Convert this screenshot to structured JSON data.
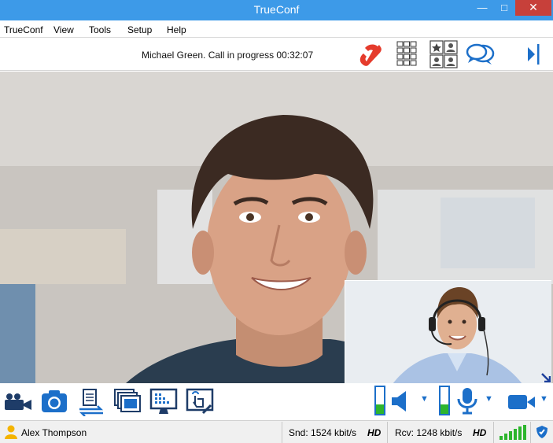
{
  "window": {
    "title": "TrueConf"
  },
  "menu": {
    "items": [
      "TrueConf",
      "View",
      "Tools",
      "Setup",
      "Help"
    ]
  },
  "call": {
    "status_text": "Michael Green. Call in progress 00:32:07"
  },
  "callbar_icons": [
    "hang-up-icon",
    "dialpad-icon",
    "address-book-icon",
    "chat-icon",
    "collapse-panel-icon"
  ],
  "toolbar_icons": [
    "camera-icon",
    "snapshot-icon",
    "file-transfer-icon",
    "slideshow-icon",
    "screen-share-icon",
    "remote-desktop-icon",
    "speaker-icon",
    "microphone-icon",
    "video-camera-icon"
  ],
  "levels": {
    "speaker_level": 0.35,
    "mic_level": 0.35
  },
  "status": {
    "user_name": "Alex Thompson",
    "send_label": "Snd: 1524 kbit/s",
    "send_quality": "HD",
    "receive_label": "Rcv: 1248 kbit/s",
    "receive_quality": "HD"
  },
  "colors": {
    "titlebar": "#3d9ae8",
    "close": "#c7403a",
    "accent": "#1c6fc9",
    "hang_up": "#e53b2c",
    "signal": "#2db52d"
  }
}
